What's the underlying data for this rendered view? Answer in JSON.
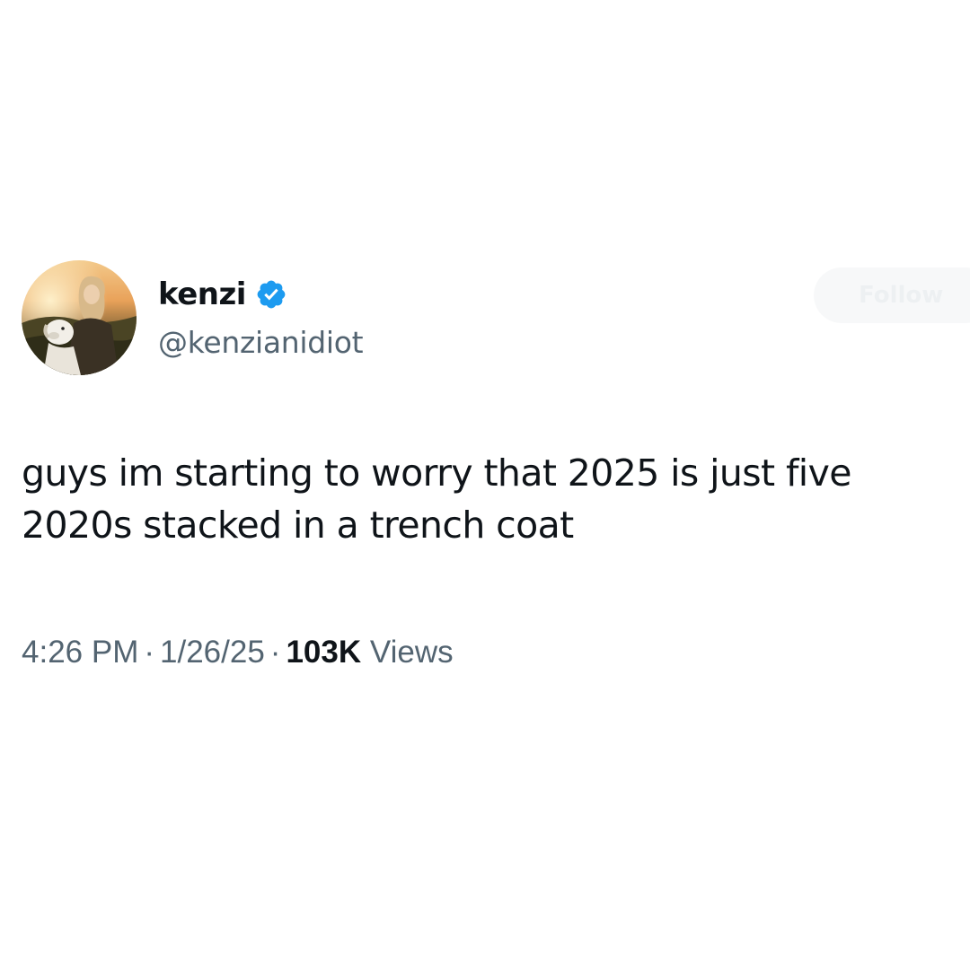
{
  "author": {
    "display_name": "kenzi",
    "handle": "@kenzianidiot",
    "verified": true,
    "verified_color": "#1d9bf0",
    "avatar_icon": "profile-photo-avatar"
  },
  "follow_button": {
    "label": "Follow"
  },
  "tweet": {
    "line1": "guys im starting to worry that 2025 is just five",
    "line2": "2020s stacked in a trench coat"
  },
  "meta": {
    "time": "4:26 PM",
    "separator": "·",
    "date": "1/26/25",
    "views_count": "103K",
    "views_label": "Views"
  },
  "colors": {
    "text_primary": "#0f1419",
    "text_secondary": "#536471",
    "background": "#ffffff"
  }
}
